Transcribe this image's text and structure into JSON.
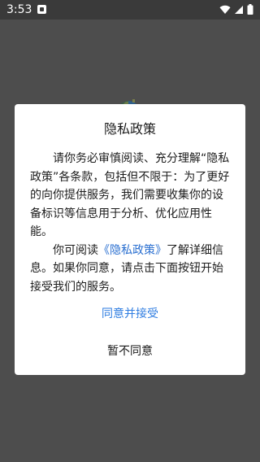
{
  "status_bar": {
    "time": "3:53",
    "icons": [
      "notification-icon",
      "wifi-icon",
      "signal-icon",
      "battery-icon"
    ]
  },
  "splash": {
    "logo": "app-logo-icon"
  },
  "dialog": {
    "title": "隐私政策",
    "paragraph1": "请你务必审慎阅读、充分理解“隐私政策”各条款，包括但不限于：为了更好的向你提供服务，我们需要收集你的设备标识等信息用于分析、优化应用性能。",
    "paragraph2_before": "你可阅读",
    "paragraph2_link": "《隐私政策》",
    "paragraph2_after": "了解详细信息。如果你同意，请点击下面按钮开始接受我们的服务。",
    "agree_label": "同意并接受",
    "disagree_label": "暂不同意"
  },
  "colors": {
    "overlay_background": "#4d4d4d",
    "status_bar": "#3a3a3a",
    "dialog_background": "#ffffff",
    "link": "#2a6fd0",
    "accent": "#2f7de1",
    "text": "#1c1c1c"
  }
}
